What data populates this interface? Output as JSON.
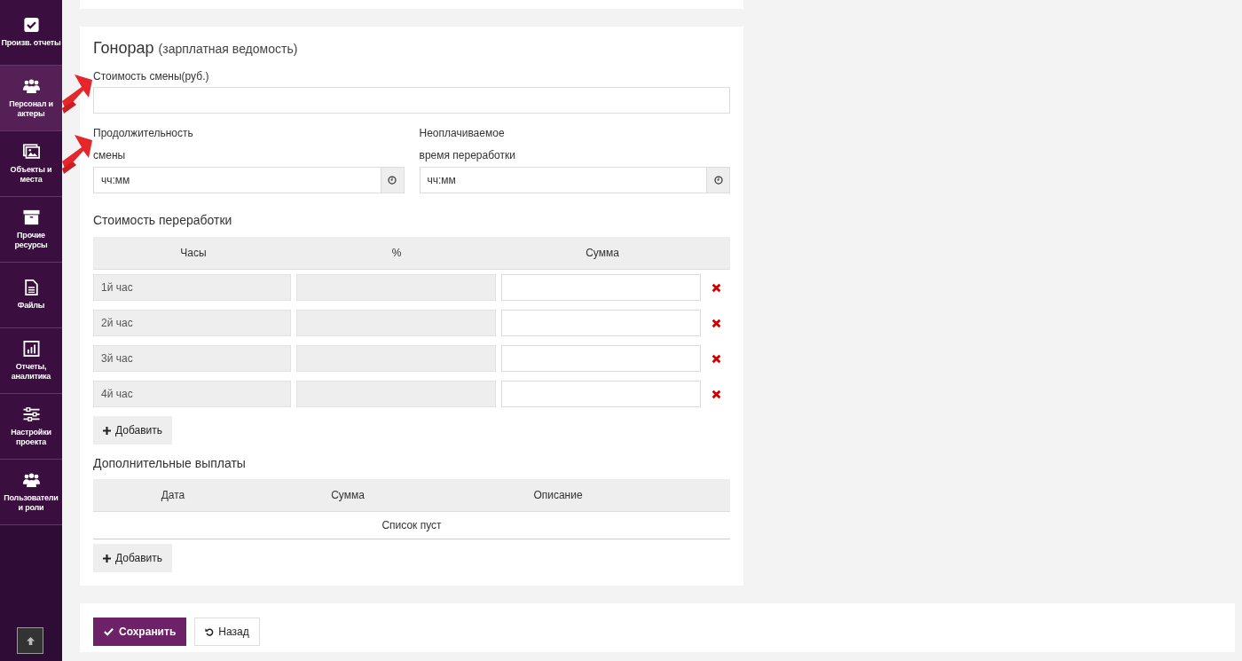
{
  "sidebar": {
    "items": [
      {
        "label": "Произв. отчеты",
        "selected": false
      },
      {
        "label": "Персонал и актеры",
        "selected": true
      },
      {
        "label": "Объекты и места",
        "selected": false
      },
      {
        "label": "Прочие ресурсы",
        "selected": false
      },
      {
        "label": "Файлы",
        "selected": false
      },
      {
        "label": "Отчеты, аналитика",
        "selected": false
      },
      {
        "label": "Настройки проекта",
        "selected": false
      },
      {
        "label": "Пользователи и роли",
        "selected": false
      }
    ]
  },
  "form": {
    "title": "Гонорар",
    "subtitle": "(зарплатная ведомость)",
    "shift_cost": {
      "label": "Стоимость смены(руб.)"
    },
    "time_fields": [
      {
        "label": "Продолжительность смены",
        "placeholder": "чч:мм"
      },
      {
        "label": "Неоплачиваемое время переработки",
        "placeholder": "чч:мм"
      }
    ],
    "overtime": {
      "title": "Стоимость переработки",
      "columns": [
        "Часы",
        "%",
        "Сумма"
      ],
      "rows": [
        {
          "hours": "1й час"
        },
        {
          "hours": "2й час"
        },
        {
          "hours": "3й час"
        },
        {
          "hours": "4й час"
        }
      ],
      "add_button": "Добавить"
    },
    "extra": {
      "title": "Дополнительные выплаты",
      "columns": [
        "Дата",
        "Сумма",
        "Описание"
      ],
      "empty": "Список пуст",
      "add_button": "Добавить"
    }
  },
  "actions": {
    "save": "Сохранить",
    "back": "Назад"
  },
  "annotations": [
    {
      "kind": "arrow"
    },
    {
      "kind": "arrow"
    }
  ]
}
